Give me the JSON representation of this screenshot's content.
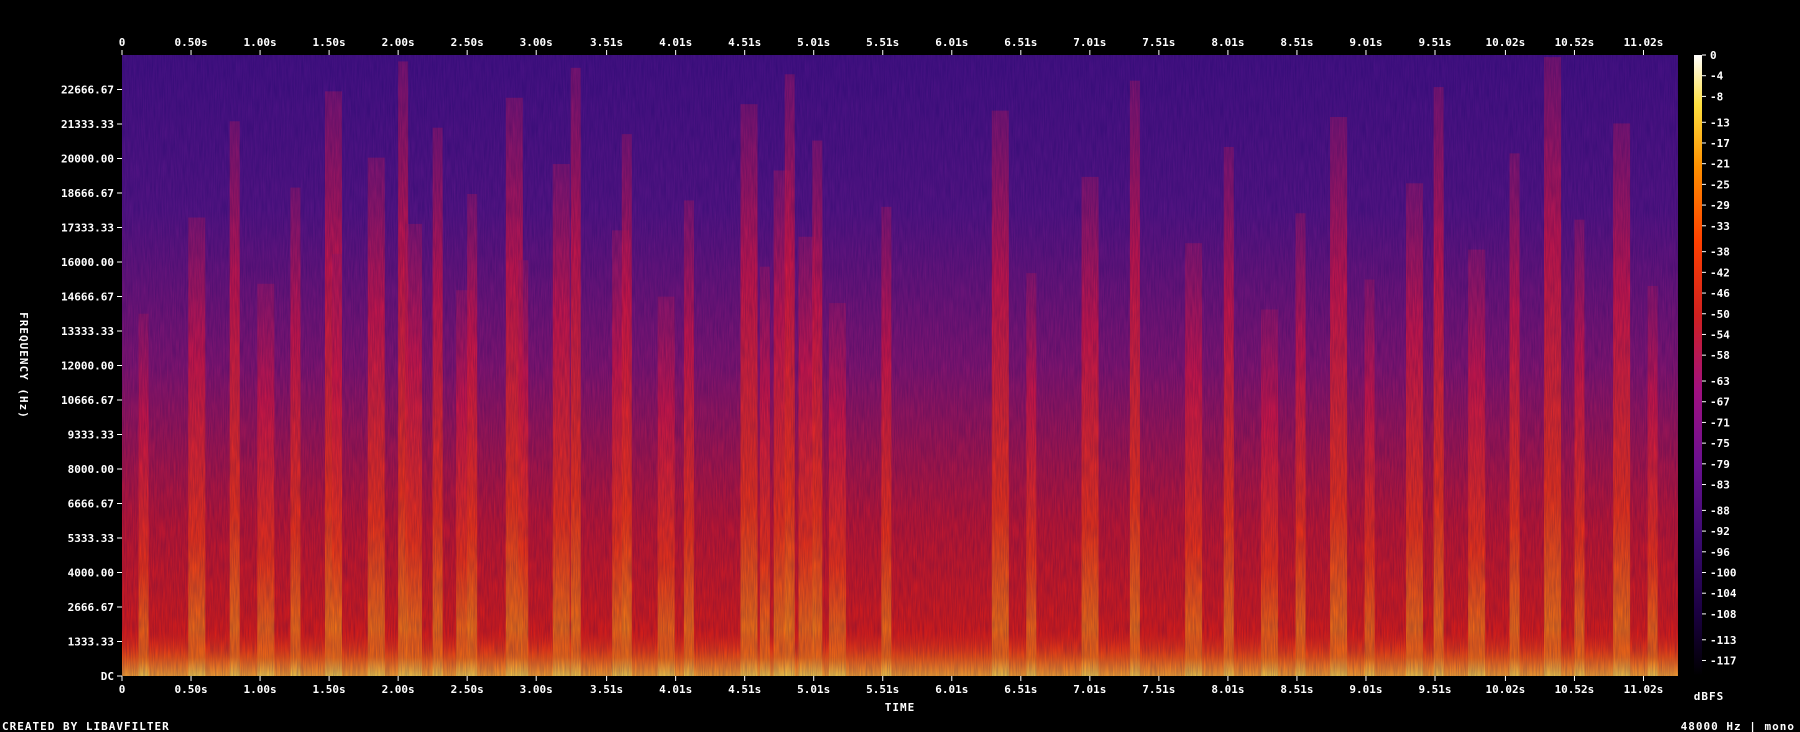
{
  "chart_data": {
    "type": "heatmap",
    "subtype": "spectrogram",
    "xlabel": "TIME",
    "ylabel": "FREQUENCY (Hz)",
    "x_ticks": [
      "0",
      "0.50s",
      "1.00s",
      "1.50s",
      "2.00s",
      "2.50s",
      "3.00s",
      "3.51s",
      "4.01s",
      "4.51s",
      "5.01s",
      "5.51s",
      "6.01s",
      "6.51s",
      "7.01s",
      "7.51s",
      "8.01s",
      "8.51s",
      "9.01s",
      "9.51s",
      "10.02s",
      "10.52s",
      "11.02s"
    ],
    "x_tick_values": [
      0,
      0.5,
      1.0,
      1.5,
      2.0,
      2.5,
      3.0,
      3.51,
      4.01,
      4.51,
      5.01,
      5.51,
      6.01,
      6.51,
      7.01,
      7.51,
      8.01,
      8.51,
      9.01,
      9.51,
      10.02,
      10.52,
      11.02
    ],
    "xlim": [
      0,
      11.27
    ],
    "y_ticks": [
      "DC",
      "1333.33",
      "2666.67",
      "4000.00",
      "5333.33",
      "6666.67",
      "8000.00",
      "9333.33",
      "10666.67",
      "12000.00",
      "13333.33",
      "14666.67",
      "16000.00",
      "17333.33",
      "18666.67",
      "20000.00",
      "21333.33",
      "22666.67"
    ],
    "y_tick_values": [
      0,
      1333.33,
      2666.67,
      4000,
      5333.33,
      6666.67,
      8000,
      9333.33,
      10666.67,
      12000,
      13333.33,
      14666.67,
      16000,
      17333.33,
      18666.67,
      20000,
      21333.33,
      22666.67
    ],
    "ylim": [
      0,
      24000
    ],
    "colorbar": {
      "label": "dBFS",
      "ticks": [
        "0",
        "-4",
        "-8",
        "-13",
        "-17",
        "-21",
        "-25",
        "-29",
        "-33",
        "-38",
        "-42",
        "-46",
        "-50",
        "-54",
        "-58",
        "-63",
        "-67",
        "-71",
        "-75",
        "-79",
        "-83",
        "-88",
        "-92",
        "-96",
        "-100",
        "-104",
        "-108",
        "-113",
        "-117"
      ],
      "range": [
        -120,
        0
      ],
      "colors": [
        "#000000",
        "#1a0040",
        "#3a0a70",
        "#6a1090",
        "#a01080",
        "#d02020",
        "#ff4000",
        "#ff9000",
        "#ffe040",
        "#ffffff"
      ]
    },
    "onsets_s": [
      0.12,
      0.48,
      0.78,
      0.98,
      1.22,
      1.47,
      1.52,
      1.78,
      2.0,
      2.05,
      2.25,
      2.42,
      2.5,
      2.78,
      2.87,
      3.12,
      3.25,
      3.55,
      3.62,
      3.88,
      4.07,
      4.48,
      4.62,
      4.72,
      4.8,
      4.9,
      5.0,
      5.12,
      5.5,
      6.3,
      6.55,
      6.95,
      7.3,
      7.7,
      7.98,
      8.25,
      8.5,
      8.75,
      9.0,
      9.3,
      9.5,
      9.75,
      10.05,
      10.3,
      10.52,
      10.8,
      11.05
    ],
    "grid": false,
    "legend_position": "right"
  },
  "footer": {
    "left": "CREATED BY LIBAVFILTER",
    "right": "48000 Hz | mono"
  }
}
